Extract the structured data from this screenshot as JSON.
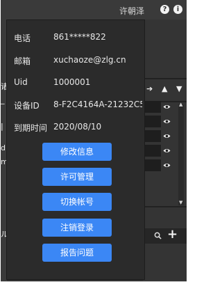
{
  "header": {
    "username": "许朝泽",
    "help_icon": "help-icon",
    "info_icon": "info-icon"
  },
  "profile": {
    "fields": [
      {
        "label": "电话",
        "value": "861*****822"
      },
      {
        "label": "邮箱",
        "value": "xuchaoze@zlg.cn"
      },
      {
        "label": "Uid",
        "value": "1000001"
      },
      {
        "label": "设备ID",
        "value": "8-F2C4164A-21232C5"
      },
      {
        "label": "到期时间",
        "value": "2020/08/10"
      }
    ],
    "actions": [
      "修改信息",
      "许可管理",
      "切换帐号",
      "注销登录",
      "报告问题"
    ]
  },
  "background": {
    "left_fragments": [
      "诸",
      "_",
      "|",
      "d",
      "m",
      "ル"
    ],
    "toolbar_icons": [
      "arrow-right-icon",
      "arrow-up-icon",
      "arrow-down-icon"
    ],
    "search_icon": "search-icon",
    "add_icon": "plus-icon",
    "add_label": "+",
    "visible_rows": 5,
    "accent": "#3b87f5"
  }
}
